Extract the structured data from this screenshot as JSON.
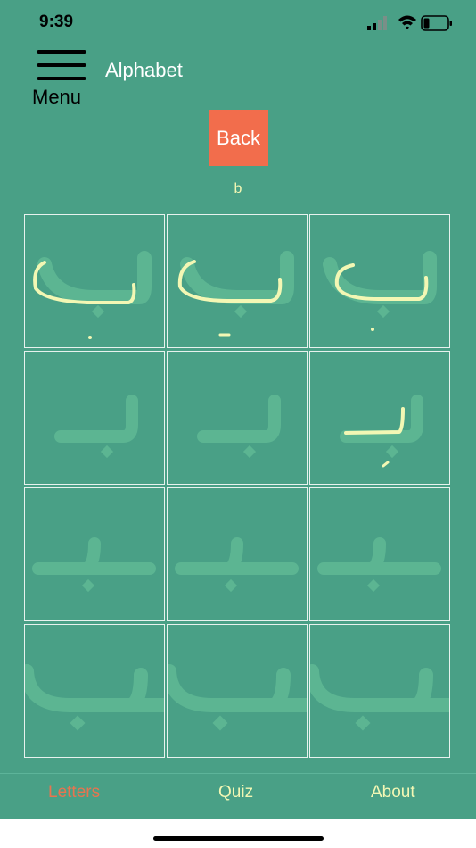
{
  "status": {
    "time": "9:39"
  },
  "header": {
    "menu_label": "Menu",
    "title": "Alphabet"
  },
  "back_label": "Back",
  "letter_name": "b",
  "colors": {
    "background": "#49a086",
    "accent": "#f26d4c",
    "trace": "#f3f7b4",
    "guide": "#5cb592"
  },
  "tabs": {
    "letters": "Letters",
    "quiz": "Quiz",
    "about": "About"
  }
}
